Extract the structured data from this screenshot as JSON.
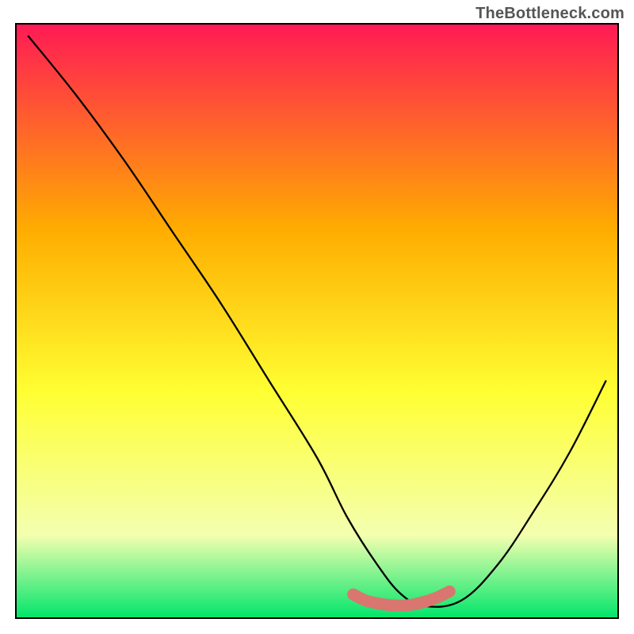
{
  "watermark": "TheBottleneck.com",
  "chart_data": {
    "type": "line",
    "title": "",
    "xlabel": "",
    "ylabel": "",
    "xlim": [
      0,
      100
    ],
    "ylim": [
      0,
      100
    ],
    "background_gradient": {
      "top": "#ff1a55",
      "mid1": "#ffae00",
      "mid2": "#ffff33",
      "mid3": "#f4ffb0",
      "bottom": "#00e56a"
    },
    "series": [
      {
        "name": "bottleneck-curve",
        "color": "#000000",
        "x": [
          2,
          10,
          18,
          26,
          34,
          42,
          50,
          55,
          60,
          64,
          68,
          74,
          80,
          86,
          92,
          98
        ],
        "y": [
          98,
          88,
          77,
          65,
          53,
          40,
          27,
          17,
          9,
          4,
          2,
          3,
          9,
          18,
          28,
          40
        ]
      }
    ],
    "highlight_band": {
      "name": "optimal-range",
      "color": "#d9766f",
      "x": [
        56,
        58,
        60,
        62,
        64,
        66,
        68,
        70,
        72
      ],
      "y": [
        4,
        3,
        2.5,
        2.2,
        2.1,
        2.3,
        2.8,
        3.5,
        4.5
      ]
    }
  }
}
